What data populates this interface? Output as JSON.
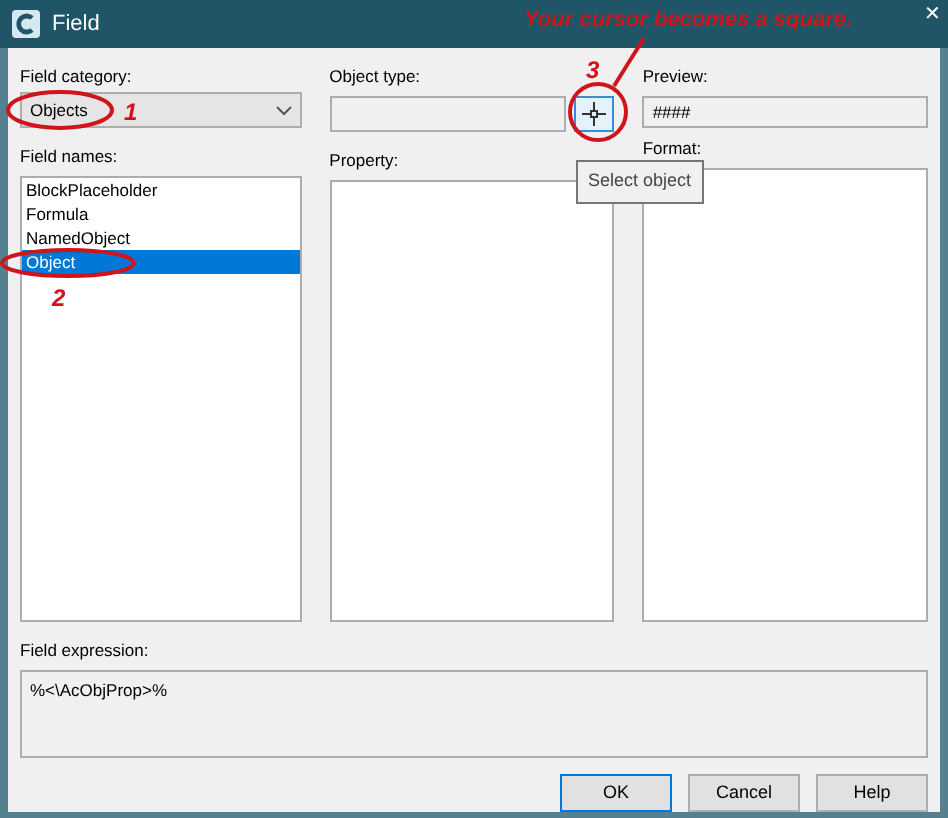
{
  "window": {
    "title": "Field",
    "close": "✕"
  },
  "field_category": {
    "label": "Field category:",
    "value": "Objects"
  },
  "field_names": {
    "label": "Field names:",
    "items": [
      {
        "text": "BlockPlaceholder",
        "selected": false
      },
      {
        "text": "Formula",
        "selected": false
      },
      {
        "text": "NamedObject",
        "selected": false
      },
      {
        "text": "Object",
        "selected": true
      }
    ]
  },
  "object_type": {
    "label": "Object type:"
  },
  "select_object": {
    "tooltip": "Select object"
  },
  "property": {
    "label": "Property:"
  },
  "preview": {
    "label": "Preview:",
    "value": "####"
  },
  "format": {
    "label": "Format:"
  },
  "field_expression": {
    "label": "Field expression:",
    "value": "%<\\AcObjProp>%"
  },
  "buttons": [
    {
      "label": "OK",
      "default": true
    },
    {
      "label": "Cancel",
      "default": false
    },
    {
      "label": "Help",
      "default": false
    }
  ],
  "annotations": [
    {
      "kind": "callout",
      "text": "Your cursor becomes a square."
    },
    {
      "kind": "step",
      "text": "1"
    },
    {
      "kind": "step",
      "text": "2"
    },
    {
      "kind": "step",
      "text": "3"
    }
  ]
}
